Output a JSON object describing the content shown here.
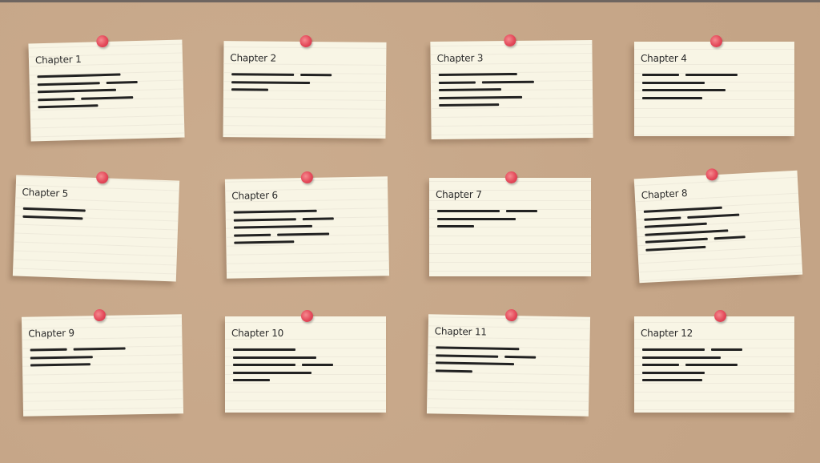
{
  "colors": {
    "board": "#c8a98b",
    "card": "#f8f5e5",
    "pin": "#e4495a",
    "text_lines": "#222222"
  },
  "cards": [
    {
      "title": "Chapter 1",
      "text_lines": 5
    },
    {
      "title": "Chapter 2",
      "text_lines": 3
    },
    {
      "title": "Chapter 3",
      "text_lines": 5
    },
    {
      "title": "Chapter 4",
      "text_lines": 4
    },
    {
      "title": "Chapter 5",
      "text_lines": 2
    },
    {
      "title": "Chapter 6",
      "text_lines": 5
    },
    {
      "title": "Chapter 7",
      "text_lines": 3
    },
    {
      "title": "Chapter 8",
      "text_lines": 6
    },
    {
      "title": "Chapter 9",
      "text_lines": 3
    },
    {
      "title": "Chapter 10",
      "text_lines": 5
    },
    {
      "title": "Chapter 11",
      "text_lines": 4
    },
    {
      "title": "Chapter 12",
      "text_lines": 5
    }
  ]
}
